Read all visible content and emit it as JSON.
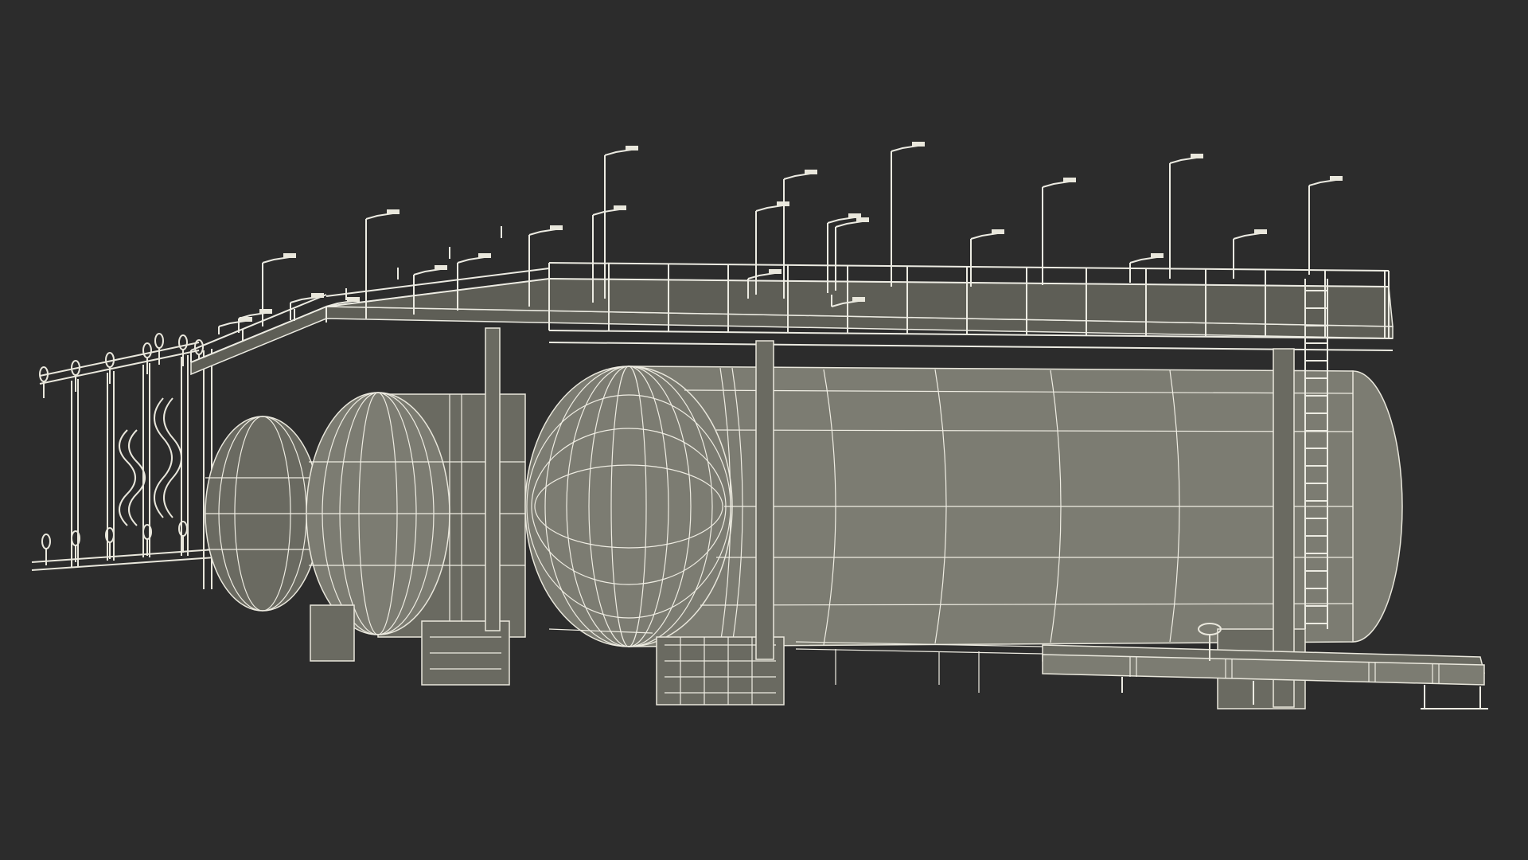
{
  "scene": {
    "background": "#2c2c2c",
    "wire_color": "#e9e7dc",
    "shell_color": "#7c7c72"
  },
  "objects": {
    "vessels": 3,
    "light_poles": 24,
    "valve_wheels": 12
  }
}
